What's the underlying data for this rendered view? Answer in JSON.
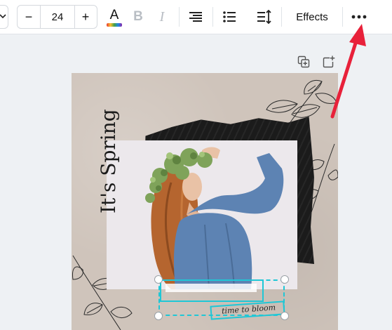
{
  "toolbar": {
    "font_size": {
      "decrease_label": "−",
      "value": "24",
      "increase_label": "+"
    },
    "text_color_letter": "A",
    "bold_label": "B",
    "italic_label": "I",
    "effects_label": "Effects",
    "icons": [
      "chevron-down-icon",
      "text-color-icon",
      "bold-icon",
      "italic-icon",
      "align-right-icon",
      "list-icon",
      "line-spacing-icon",
      "more-options-icon"
    ]
  },
  "page_actions": {
    "icons": [
      "duplicate-page-icon",
      "add-page-icon"
    ]
  },
  "design": {
    "title": "It's Spring!",
    "caption": "time to bloom"
  },
  "annotation": {
    "arrow_color": "#e8213a"
  },
  "colors": {
    "selection": "#1fc7d6",
    "design_background": "#cfc4bb",
    "torn_paper": "#1b1b1b",
    "sweater": "#5d83b3",
    "foliage": "#7fa35a"
  }
}
